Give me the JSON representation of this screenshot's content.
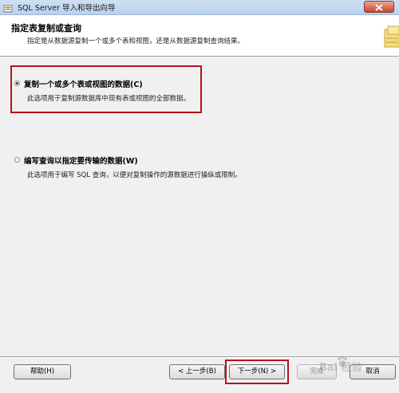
{
  "window": {
    "title": "SQL Server 导入和导出向导"
  },
  "header": {
    "title": "指定表复制或查询",
    "subtitle": "指定是从数据源复制一个或多个表和视图，还是从数据源复制查询结果。"
  },
  "options": [
    {
      "label": "复制一个或多个表或视图的数据(C)",
      "description": "此选项用于复制源数据库中现有表或视图的全部数据。",
      "selected": true
    },
    {
      "label": "编写查询以指定要传输的数据(W)",
      "description": "此选项用于编写 SQL 查询，以便对复制操作的源数据进行操纵或限制。",
      "selected": false
    }
  ],
  "footer": {
    "help": "帮助(H)",
    "back": "< 上一步(B)",
    "next": "下一步(N) >",
    "finish": "完成",
    "cancel": "取消"
  },
  "watermark": "Bai 经验",
  "colors": {
    "highlight": "#b4131d",
    "window_bg": "#f0f0f0"
  }
}
